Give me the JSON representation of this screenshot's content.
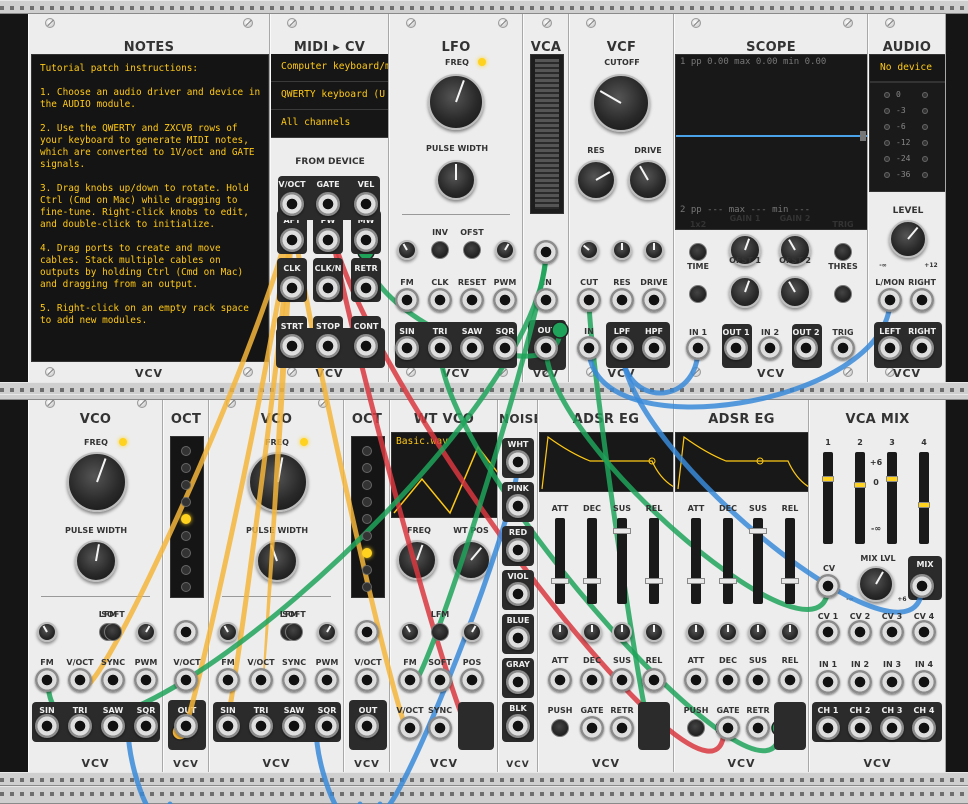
{
  "modules_top": {
    "notes": {
      "title": "NOTES",
      "text": "Tutorial patch instructions:\n\n1. Choose an audio driver and device in the AUDIO module.\n\n2. Use the QWERTY and ZXCVB rows of your keyboard to generate MIDI notes, which are converted to 1V/oct and GATE signals.\n\n3. Drag knobs up/down to rotate. Hold Ctrl (Cmd on Mac) while dragging to fine-tune. Right-click knobs to edit, and double-click to initialize.\n\n4. Drag ports to create and move cables. Stack multiple cables on outputs by holding Ctrl (Cmd on Mac) and dragging from an output.\n\n5. Right-click on an empty rack space to add new modules."
    },
    "midi_cv": {
      "title": "MIDI ▸ CV",
      "driver": "Computer keyboard/m",
      "device": "QWERTY keyboard (U",
      "channel": "All channels",
      "from_device": "FROM DEVICE",
      "ports": [
        "V/OCT",
        "GATE",
        "VEL",
        "AFT",
        "PW",
        "MW",
        "CLK",
        "CLK/N",
        "RETR",
        "STRT",
        "STOP",
        "CONT"
      ]
    },
    "lfo": {
      "title": "LFO",
      "freq": "FREQ",
      "pulse_width": "PULSE WIDTH",
      "params": [
        "INV",
        "OFST"
      ],
      "inputs": [
        "FM",
        "CLK",
        "RESET",
        "PWM"
      ],
      "outputs": [
        "SIN",
        "TRI",
        "SAW",
        "SQR"
      ]
    },
    "vca": {
      "title": "VCA",
      "inp": "IN",
      "out": "OUT"
    },
    "vcf": {
      "title": "VCF",
      "cutoff": "CUTOFF",
      "res": "RES",
      "drive": "DRIVE",
      "inputs": [
        "CUT",
        "RES",
        "DRIVE"
      ],
      "inp": "IN",
      "lpf": "LPF",
      "hpf": "HPF"
    },
    "scope": {
      "title": "SCOPE",
      "top_readout": "1 pp   0.00 max   0.00 min   0.00",
      "bot_readout": "2 pp   ---  max   ---  min   ---",
      "knobs": [
        "1x2",
        "GAIN 1",
        "GAIN 2",
        "TRIG",
        "TIME",
        "OFST 1",
        "OFST 2",
        "THRES"
      ],
      "ports": [
        "IN 1",
        "OUT 1",
        "IN 2",
        "OUT 2",
        "TRIG"
      ]
    },
    "audio": {
      "title": "AUDIO",
      "device": "No device",
      "levels": [
        "0",
        "-3",
        "-6",
        "-12",
        "-24",
        "-36"
      ],
      "level": "LEVEL",
      "min": "-∞",
      "max": "+12",
      "ports": [
        "L/MON",
        "RIGHT",
        "LEFT",
        "RIGHT"
      ]
    }
  },
  "modules_bottom": {
    "vco1": {
      "title": "VCO",
      "freq": "FREQ",
      "pulse_width": "PULSE WIDTH",
      "switches": [
        "LFM",
        "SOFT"
      ],
      "inputs": [
        "FM",
        "V/OCT",
        "SYNC",
        "PWM"
      ],
      "outputs": [
        "SIN",
        "TRI",
        "SAW",
        "SQR"
      ]
    },
    "oct1": {
      "title": "OCT",
      "port": "V/OCT",
      "out": "OUT"
    },
    "vco2": {
      "title": "VCO",
      "freq": "FREQ",
      "pulse_width": "PULSE WIDTH",
      "switches": [
        "LFM",
        "SOFT"
      ],
      "inputs": [
        "FM",
        "V/OCT",
        "SYNC",
        "PWM"
      ],
      "outputs": [
        "SIN",
        "TRI",
        "SAW",
        "SQR"
      ]
    },
    "oct2": {
      "title": "OCT",
      "port": "V/OCT",
      "out": "OUT"
    },
    "wtvco": {
      "title": "WT VCO",
      "wave": "Basic.wav",
      "knobs": [
        "FREQ",
        "WT POS"
      ],
      "switches": [
        "LFM",
        "SOFT"
      ],
      "inputs": [
        "FM",
        "SOFT",
        "POS"
      ],
      "bottom": [
        "V/OCT",
        "SYNC",
        "WT"
      ]
    },
    "noise": {
      "title": "NOISE",
      "outputs": [
        "WHT",
        "PINK",
        "RED",
        "VIOL",
        "BLUE",
        "GRAY",
        "BLK"
      ]
    },
    "adsr1": {
      "title": "ADSR EG",
      "sliders": [
        "ATT",
        "DEC",
        "SUS",
        "REL"
      ],
      "knobs": [
        "ATT",
        "DEC",
        "SUS",
        "REL"
      ],
      "bottom": [
        "PUSH",
        "GATE",
        "RETR",
        "ENV"
      ]
    },
    "adsr2": {
      "title": "ADSR EG",
      "sliders": [
        "ATT",
        "DEC",
        "SUS",
        "REL"
      ],
      "knobs": [
        "ATT",
        "DEC",
        "SUS",
        "REL"
      ],
      "bottom": [
        "PUSH",
        "GATE",
        "RETR",
        "ENV"
      ]
    },
    "vcamix": {
      "title": "VCA MIX",
      "channels": [
        "1",
        "2",
        "3",
        "4"
      ],
      "scale": [
        "+6",
        "0",
        "-∞"
      ],
      "mix_lvl": "MIX LVL",
      "cv": "CV",
      "mix": "MIX",
      "min": "-∞",
      "max": "+6",
      "cv_ports": [
        "CV 1",
        "CV 2",
        "CV 3",
        "CV 4"
      ],
      "in_ports": [
        "IN 1",
        "IN 2",
        "IN 3",
        "IN 4"
      ],
      "ch_ports": [
        "CH 1",
        "CH 2",
        "CH 3",
        "CH 4"
      ]
    }
  },
  "brand": "VCV",
  "colors": {
    "yellow": "#f3b53b",
    "red": "#d8383f",
    "green": "#1fa35a",
    "blue": "#3a8ad9"
  }
}
